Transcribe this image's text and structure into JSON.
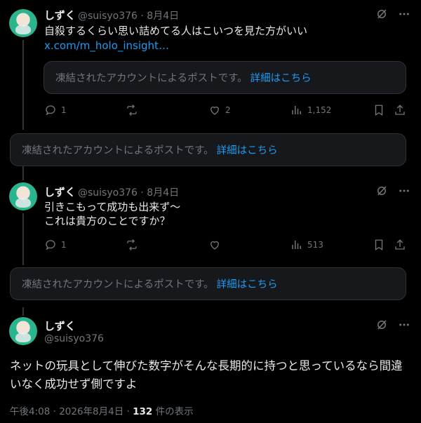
{
  "posts": [
    {
      "name": "しずく",
      "handle": "@suisyo376",
      "date": "8月4日",
      "text": "自殺するくらい思い詰めてる人はこいつを見た方がいい",
      "link": "x.com/m_holo_insight…",
      "quoted_notice": "凍結されたアカウントによるポストです。",
      "quoted_more": "詳細はこちら",
      "replies": "1",
      "reposts": "",
      "likes": "2",
      "views": "1,152"
    },
    {
      "name": "しずく",
      "handle": "@suisyo376",
      "date": "8月4日",
      "text_line1": "引きこもって成功も出来ず〜",
      "text_line2": "これは貴方のことですか？",
      "replies": "1",
      "reposts": "",
      "likes": "",
      "views": "513"
    }
  ],
  "frozen_replies": [
    {
      "notice": "凍結されたアカウントによるポストです。",
      "more": "詳細はこちら"
    },
    {
      "notice": "凍結されたアカウントによるポストです。",
      "more": "詳細はこちら"
    }
  ],
  "focused_post": {
    "name": "しずく",
    "handle": "@suisyo376",
    "text": "ネットの玩具として伸びた数字がそんな長期的に持つと思っているなら間違いなく成功せず側ですよ",
    "time": "午後4:08",
    "date": "2026年8月4日",
    "views_count": "132",
    "views_label": "件の表示"
  },
  "icons": [
    "grok-icon",
    "more-icon",
    "reply-icon",
    "repost-icon",
    "like-icon",
    "views-icon",
    "bookmark-icon",
    "share-icon"
  ]
}
